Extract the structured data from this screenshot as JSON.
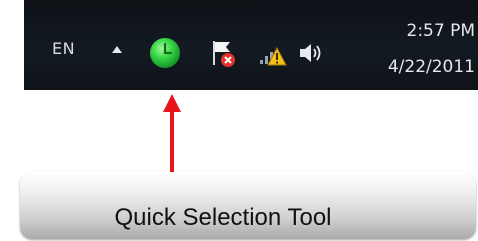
{
  "taskbar": {
    "language": "EN",
    "show_hidden_icon": "triangle-up-icon",
    "tray_icons": [
      "quick-selection-tool-icon",
      "action-center-flag-icon",
      "network-warning-icon",
      "speaker-icon"
    ],
    "clock": {
      "time": "2:57 PM",
      "date": "4/22/2011"
    }
  },
  "callout": {
    "label": "Quick Selection Tool",
    "arrow_color": "#e8141b"
  },
  "colors": {
    "taskbar_bg": "#10151c",
    "tool_icon": "#3ddc4a",
    "flag_red": "#e0322a",
    "warning_yellow": "#f2c21a"
  }
}
